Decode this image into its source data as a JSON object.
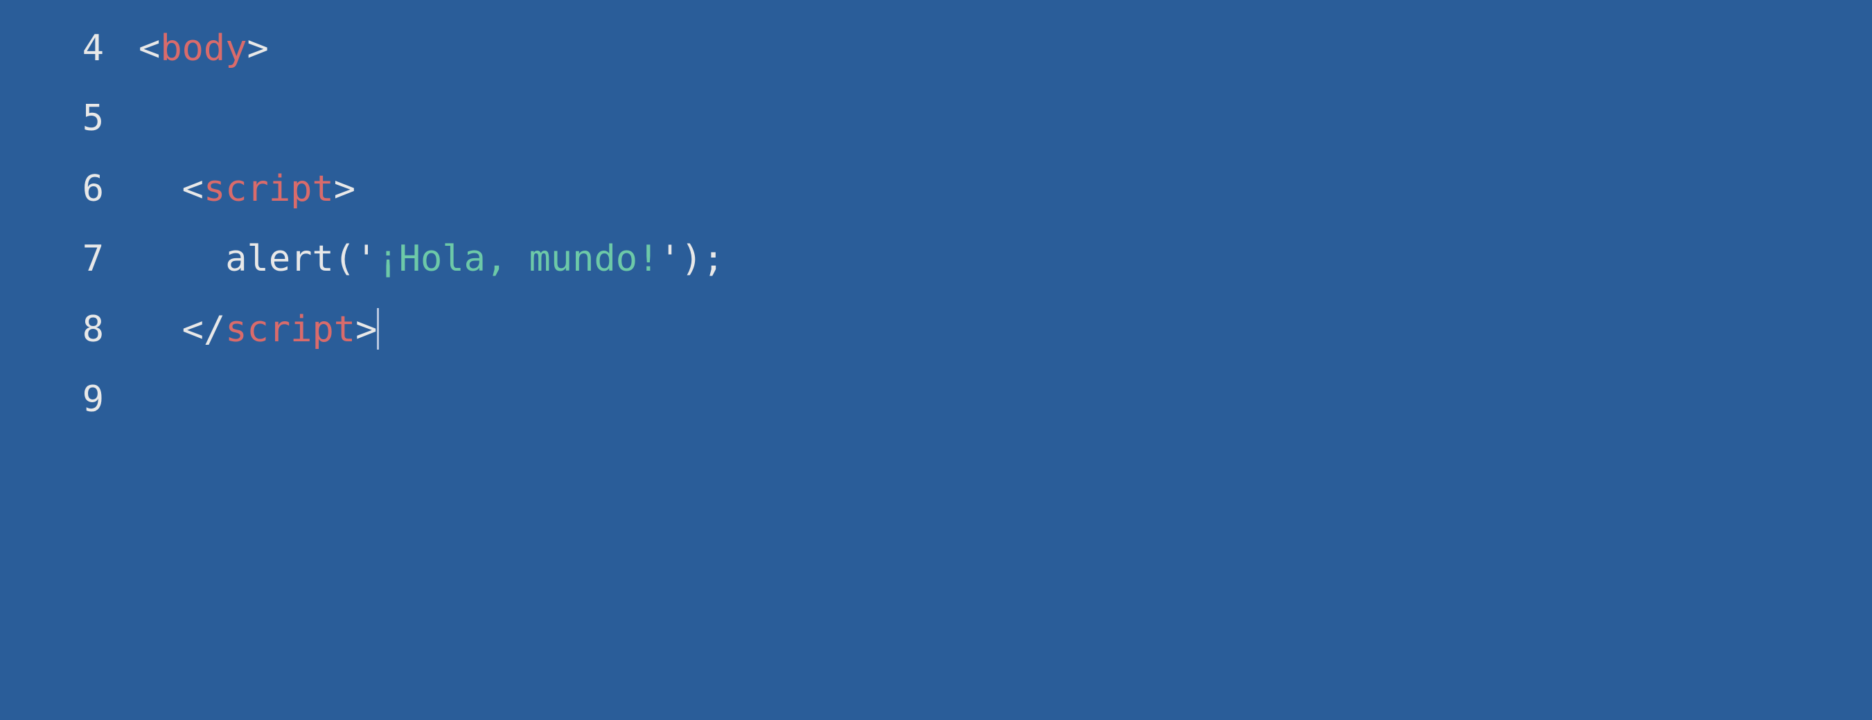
{
  "editor": {
    "lines": [
      {
        "number": "4",
        "indent": "",
        "tokens": [
          {
            "type": "bracket",
            "text": "<"
          },
          {
            "type": "tag",
            "text": "body"
          },
          {
            "type": "bracket",
            "text": ">"
          }
        ]
      },
      {
        "number": "5",
        "indent": "",
        "tokens": []
      },
      {
        "number": "6",
        "indent": "  ",
        "tokens": [
          {
            "type": "bracket",
            "text": "<"
          },
          {
            "type": "tag",
            "text": "script"
          },
          {
            "type": "bracket",
            "text": ">"
          }
        ]
      },
      {
        "number": "7",
        "indent": "    ",
        "tokens": [
          {
            "type": "func",
            "text": "alert"
          },
          {
            "type": "punct",
            "text": "("
          },
          {
            "type": "punct",
            "text": "'"
          },
          {
            "type": "string",
            "text": "¡Hola, mundo!"
          },
          {
            "type": "punct",
            "text": "'"
          },
          {
            "type": "punct",
            "text": ")"
          },
          {
            "type": "punct",
            "text": ";"
          }
        ]
      },
      {
        "number": "8",
        "indent": "  ",
        "tokens": [
          {
            "type": "bracket",
            "text": "</"
          },
          {
            "type": "tag",
            "text": "script"
          },
          {
            "type": "bracket",
            "text": ">"
          }
        ],
        "cursor": true
      },
      {
        "number": "9",
        "indent": "",
        "tokens": []
      }
    ]
  }
}
